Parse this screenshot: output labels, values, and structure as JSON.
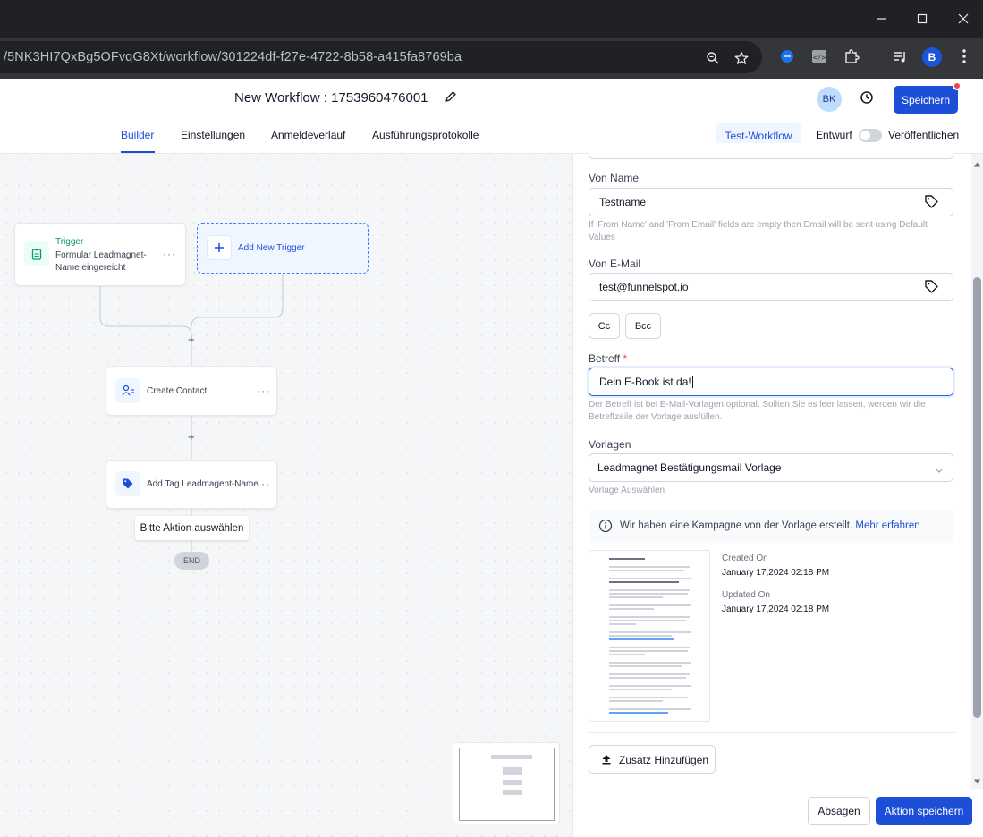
{
  "browser": {
    "url": "/5NK3HI7QxBg5OFvqG8Xt/workflow/301224df-f27e-4722-8b58-a415fa8769ba",
    "window_controls": [
      "minimize-icon",
      "maximize-icon",
      "close-icon"
    ],
    "profile_initial": "B"
  },
  "header": {
    "title": "New Workflow : 1753960476001",
    "avatar": "BK",
    "save_label": "Speichern"
  },
  "tabs": {
    "items": [
      {
        "label": "Builder",
        "active": true
      },
      {
        "label": "Einstellungen",
        "active": false
      },
      {
        "label": "Anmeldeverlauf",
        "active": false
      },
      {
        "label": "Ausführungsprotokolle",
        "active": false
      }
    ],
    "test_label": "Test-Workflow",
    "draft_label": "Entwurf",
    "publish_label": "Veröffentlichen",
    "published": false
  },
  "canvas": {
    "trigger": {
      "heading": "Trigger",
      "line1": "Formular Leadmagnet-",
      "line2": "Name eingereicht",
      "more": "···"
    },
    "add_trigger_label": "Add New Trigger",
    "plus": "+",
    "actions": [
      {
        "label": "Create Contact",
        "more": "···"
      },
      {
        "label": "Add Tag Leadmagent-Name",
        "more": "···"
      }
    ],
    "tooltip": "Bitte Aktion auswählen",
    "end_label": "END"
  },
  "panel": {
    "from_name": {
      "label": "Von Name",
      "value": "Testname",
      "help": "If 'From Name' and 'From Email' fields are empty then Email will be sent using Default Values"
    },
    "from_email": {
      "label": "Von E-Mail",
      "value": "test@funnelspot.io"
    },
    "cc_label": "Cc",
    "bcc_label": "Bcc",
    "subject": {
      "label": "Betreff",
      "required_mark": "*",
      "value": "Dein E-Book ist da!",
      "help": "Der Betreff ist bei E-Mail-Vorlagen optional. Sollten Sie es leer lassen, werden wir die Betreffzeile der Vorlage ausfüllen."
    },
    "templates": {
      "label": "Vorlagen",
      "selected": "Leadmagnet Bestätigungsmail Vorlage",
      "help": "Vorlage Auswählen"
    },
    "info": {
      "text": "Wir haben eine Kampagne von der Vorlage erstellt. ",
      "link": "Mehr erfahren"
    },
    "meta": {
      "created_label": "Created On",
      "created_value": "January 17,2024 02:18 PM",
      "updated_label": "Updated On",
      "updated_value": "January 17,2024 02:18 PM"
    },
    "add_extra_label": "Zusatz Hinzufügen",
    "cancel_label": "Absagen",
    "save_action_label": "Aktion speichern"
  },
  "colors": {
    "accent": "#1d4ed8",
    "trigger_green": "#059669",
    "canvas_bg": "#f5f6f8"
  }
}
